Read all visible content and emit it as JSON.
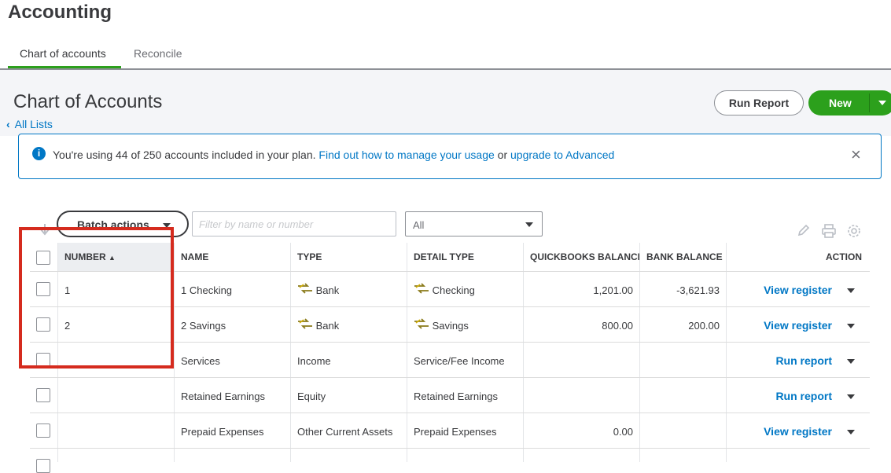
{
  "app": {
    "title": "Accounting"
  },
  "tabs": [
    {
      "label": "Chart of accounts"
    },
    {
      "label": "Reconcile"
    }
  ],
  "page": {
    "title": "Chart of Accounts",
    "back_link": "All Lists"
  },
  "buttons": {
    "run_report": "Run Report",
    "new": "New"
  },
  "banner": {
    "text_prefix": "You're using 44 of 250 accounts included in your plan.",
    "link1": "Find out how to manage your usage",
    "middle": "or",
    "link2": "upgrade to Advanced",
    "close": "×"
  },
  "toolbar": {
    "batch_actions": "Batch actions",
    "filter_placeholder": "Filter by name or number",
    "select_value": "All",
    "icons": [
      "pencil-icon",
      "printer-icon",
      "gear-icon"
    ]
  },
  "table": {
    "headers": {
      "number": "NUMBER",
      "name": "NAME",
      "type": "TYPE",
      "detail_type": "DETAIL TYPE",
      "qb_balance": "QUICKBOOKS BALANCE",
      "bank_balance": "BANK BALANCE",
      "action": "ACTION"
    },
    "rows": [
      {
        "number": "1",
        "name": "1 Checking",
        "type": "Bank",
        "detail_type": "Checking",
        "qb_balance": "1,201.00",
        "bank_balance": "-3,621.93",
        "action": "View register"
      },
      {
        "number": "2",
        "name": "2 Savings",
        "type": "Bank",
        "detail_type": "Savings",
        "qb_balance": "800.00",
        "bank_balance": "200.00",
        "action": "View register"
      },
      {
        "number": "",
        "name": "Services",
        "type": "Income",
        "detail_type": "Service/Fee Income",
        "qb_balance": "",
        "bank_balance": "",
        "action": "Run report"
      },
      {
        "number": "",
        "name": "Retained Earnings",
        "type": "Equity",
        "detail_type": "Retained Earnings",
        "qb_balance": "",
        "bank_balance": "",
        "action": "Run report"
      },
      {
        "number": "",
        "name": "Prepaid Expenses",
        "type": "Other Current Assets",
        "detail_type": "Prepaid Expenses",
        "qb_balance": "0.00",
        "bank_balance": "",
        "action": "View register"
      }
    ]
  },
  "colors": {
    "brand_green": "#2ca01c",
    "link_blue": "#0077c5",
    "highlight_red": "#d52b1e"
  }
}
